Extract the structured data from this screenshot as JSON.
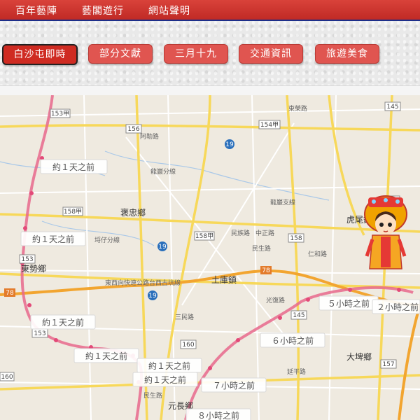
{
  "topnav": {
    "items": [
      "百年藝陣",
      "藝閣遊行",
      "網站聲明"
    ]
  },
  "tabs": [
    {
      "label": "白沙屯即時",
      "active": true
    },
    {
      "label": "部分文獻",
      "active": false
    },
    {
      "label": "三月十九",
      "active": false
    },
    {
      "label": "交通資訊",
      "active": false
    },
    {
      "label": "旅遊美食",
      "active": false
    }
  ],
  "map": {
    "places": [
      "褒忠鄉",
      "東勢鄉",
      "土庫鎮",
      "大埤鄉",
      "虎尾鎮",
      "元長鄉"
    ],
    "roads": [
      "龍巖分線",
      "龍巖支線",
      "埒仔分線",
      "東西向快速公路台西古坑線",
      "民族路",
      "光復路",
      "三民路",
      "阿勒路",
      "民生路",
      "仁和路",
      "中正路",
      "延平路",
      "民生路",
      "東榮路"
    ],
    "shields": [
      "153甲",
      "156",
      "154甲",
      "19",
      "145",
      "158甲",
      "158甲",
      "19",
      "158",
      "153",
      "78",
      "78",
      "19",
      "145",
      "153",
      "160",
      "157",
      "145",
      "160"
    ],
    "time_labels": [
      "約１天之前",
      "約１天之前",
      "約１天之前",
      "約１天之前",
      "約１天之前",
      "約１天之前",
      "５小時之前",
      "２小時之前",
      "６小時之前",
      "７小時之前",
      "８小時之前"
    ],
    "colors": {
      "route": "#e8688c",
      "route_dot": "#e34a78",
      "highway": "#f2a530",
      "road": "#f7d85a",
      "background": "#efeae0"
    },
    "marker": "mazu-goddess-icon"
  }
}
